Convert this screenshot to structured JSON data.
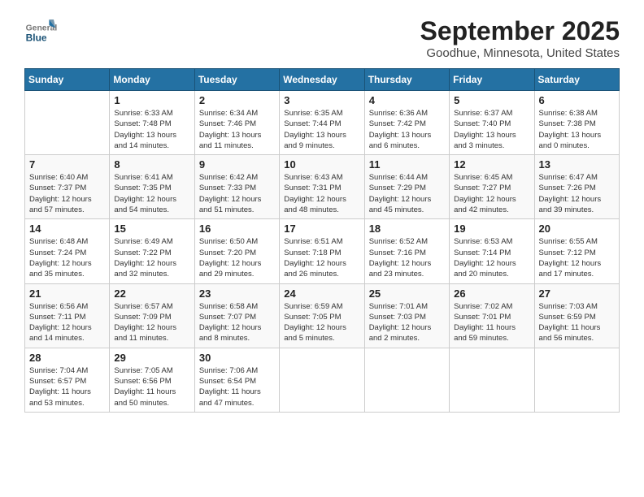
{
  "header": {
    "logo_general": "General",
    "logo_blue": "Blue",
    "month": "September 2025",
    "location": "Goodhue, Minnesota, United States"
  },
  "days_of_week": [
    "Sunday",
    "Monday",
    "Tuesday",
    "Wednesday",
    "Thursday",
    "Friday",
    "Saturday"
  ],
  "weeks": [
    [
      {
        "day": "",
        "info": ""
      },
      {
        "day": "1",
        "info": "Sunrise: 6:33 AM\nSunset: 7:48 PM\nDaylight: 13 hours\nand 14 minutes."
      },
      {
        "day": "2",
        "info": "Sunrise: 6:34 AM\nSunset: 7:46 PM\nDaylight: 13 hours\nand 11 minutes."
      },
      {
        "day": "3",
        "info": "Sunrise: 6:35 AM\nSunset: 7:44 PM\nDaylight: 13 hours\nand 9 minutes."
      },
      {
        "day": "4",
        "info": "Sunrise: 6:36 AM\nSunset: 7:42 PM\nDaylight: 13 hours\nand 6 minutes."
      },
      {
        "day": "5",
        "info": "Sunrise: 6:37 AM\nSunset: 7:40 PM\nDaylight: 13 hours\nand 3 minutes."
      },
      {
        "day": "6",
        "info": "Sunrise: 6:38 AM\nSunset: 7:38 PM\nDaylight: 13 hours\nand 0 minutes."
      }
    ],
    [
      {
        "day": "7",
        "info": "Sunrise: 6:40 AM\nSunset: 7:37 PM\nDaylight: 12 hours\nand 57 minutes."
      },
      {
        "day": "8",
        "info": "Sunrise: 6:41 AM\nSunset: 7:35 PM\nDaylight: 12 hours\nand 54 minutes."
      },
      {
        "day": "9",
        "info": "Sunrise: 6:42 AM\nSunset: 7:33 PM\nDaylight: 12 hours\nand 51 minutes."
      },
      {
        "day": "10",
        "info": "Sunrise: 6:43 AM\nSunset: 7:31 PM\nDaylight: 12 hours\nand 48 minutes."
      },
      {
        "day": "11",
        "info": "Sunrise: 6:44 AM\nSunset: 7:29 PM\nDaylight: 12 hours\nand 45 minutes."
      },
      {
        "day": "12",
        "info": "Sunrise: 6:45 AM\nSunset: 7:27 PM\nDaylight: 12 hours\nand 42 minutes."
      },
      {
        "day": "13",
        "info": "Sunrise: 6:47 AM\nSunset: 7:26 PM\nDaylight: 12 hours\nand 39 minutes."
      }
    ],
    [
      {
        "day": "14",
        "info": "Sunrise: 6:48 AM\nSunset: 7:24 PM\nDaylight: 12 hours\nand 35 minutes."
      },
      {
        "day": "15",
        "info": "Sunrise: 6:49 AM\nSunset: 7:22 PM\nDaylight: 12 hours\nand 32 minutes."
      },
      {
        "day": "16",
        "info": "Sunrise: 6:50 AM\nSunset: 7:20 PM\nDaylight: 12 hours\nand 29 minutes."
      },
      {
        "day": "17",
        "info": "Sunrise: 6:51 AM\nSunset: 7:18 PM\nDaylight: 12 hours\nand 26 minutes."
      },
      {
        "day": "18",
        "info": "Sunrise: 6:52 AM\nSunset: 7:16 PM\nDaylight: 12 hours\nand 23 minutes."
      },
      {
        "day": "19",
        "info": "Sunrise: 6:53 AM\nSunset: 7:14 PM\nDaylight: 12 hours\nand 20 minutes."
      },
      {
        "day": "20",
        "info": "Sunrise: 6:55 AM\nSunset: 7:12 PM\nDaylight: 12 hours\nand 17 minutes."
      }
    ],
    [
      {
        "day": "21",
        "info": "Sunrise: 6:56 AM\nSunset: 7:11 PM\nDaylight: 12 hours\nand 14 minutes."
      },
      {
        "day": "22",
        "info": "Sunrise: 6:57 AM\nSunset: 7:09 PM\nDaylight: 12 hours\nand 11 minutes."
      },
      {
        "day": "23",
        "info": "Sunrise: 6:58 AM\nSunset: 7:07 PM\nDaylight: 12 hours\nand 8 minutes."
      },
      {
        "day": "24",
        "info": "Sunrise: 6:59 AM\nSunset: 7:05 PM\nDaylight: 12 hours\nand 5 minutes."
      },
      {
        "day": "25",
        "info": "Sunrise: 7:01 AM\nSunset: 7:03 PM\nDaylight: 12 hours\nand 2 minutes."
      },
      {
        "day": "26",
        "info": "Sunrise: 7:02 AM\nSunset: 7:01 PM\nDaylight: 11 hours\nand 59 minutes."
      },
      {
        "day": "27",
        "info": "Sunrise: 7:03 AM\nSunset: 6:59 PM\nDaylight: 11 hours\nand 56 minutes."
      }
    ],
    [
      {
        "day": "28",
        "info": "Sunrise: 7:04 AM\nSunset: 6:57 PM\nDaylight: 11 hours\nand 53 minutes."
      },
      {
        "day": "29",
        "info": "Sunrise: 7:05 AM\nSunset: 6:56 PM\nDaylight: 11 hours\nand 50 minutes."
      },
      {
        "day": "30",
        "info": "Sunrise: 7:06 AM\nSunset: 6:54 PM\nDaylight: 11 hours\nand 47 minutes."
      },
      {
        "day": "",
        "info": ""
      },
      {
        "day": "",
        "info": ""
      },
      {
        "day": "",
        "info": ""
      },
      {
        "day": "",
        "info": ""
      }
    ]
  ]
}
